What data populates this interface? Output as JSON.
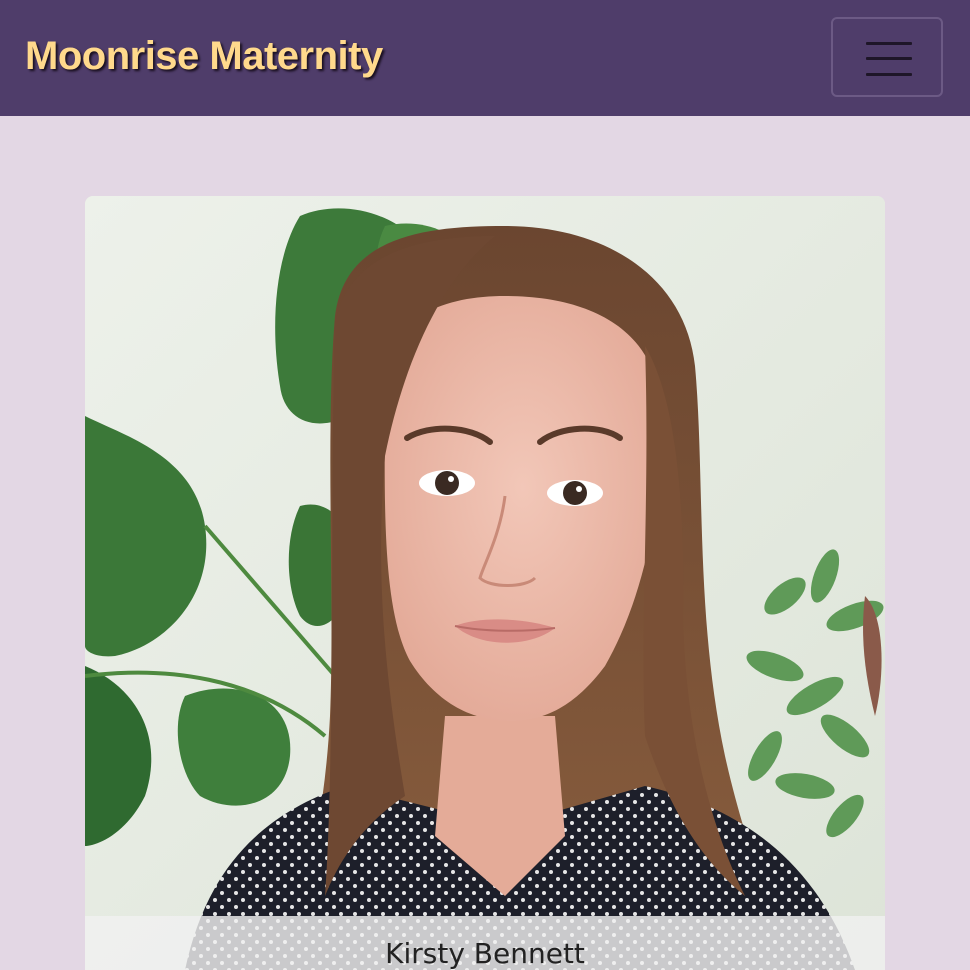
{
  "navbar": {
    "brand": "Moonrise Maternity",
    "menu_toggle_icon": "hamburger-menu-icon"
  },
  "profile": {
    "name": "Kirsty Bennett",
    "photo_description_icon": "profile-photo"
  },
  "colors": {
    "navbar_bg": "#4f3d6a",
    "brand_text": "#ffd98c",
    "page_bg": "#e3d7e4"
  }
}
